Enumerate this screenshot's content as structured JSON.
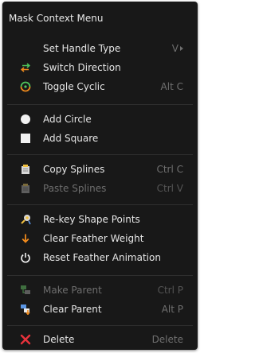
{
  "menu": {
    "title": "Mask Context Menu",
    "items": [
      {
        "label": "Set Handle Type",
        "shortcut": "V",
        "icon": "none"
      },
      {
        "label": "Switch Direction",
        "shortcut": "",
        "icon": "switch-direction-icon"
      },
      {
        "label": "Toggle Cyclic",
        "shortcut": "Alt C",
        "icon": "toggle-cyclic-icon"
      },
      {
        "label": "Add Circle",
        "shortcut": "",
        "icon": "circle-icon"
      },
      {
        "label": "Add Square",
        "shortcut": "",
        "icon": "square-icon"
      },
      {
        "label": "Copy Splines",
        "shortcut": "Ctrl C",
        "icon": "copy-icon"
      },
      {
        "label": "Paste Splines",
        "shortcut": "Ctrl V",
        "icon": "paste-icon"
      },
      {
        "label": "Re-key Shape Points",
        "shortcut": "",
        "icon": "rekey-icon"
      },
      {
        "label": "Clear Feather Weight",
        "shortcut": "",
        "icon": "clear-feather-icon"
      },
      {
        "label": "Reset Feather Animation",
        "shortcut": "",
        "icon": "power-icon"
      },
      {
        "label": "Make Parent",
        "shortcut": "Ctrl P",
        "icon": "make-parent-icon"
      },
      {
        "label": "Clear Parent",
        "shortcut": "Alt P",
        "icon": "clear-parent-icon"
      },
      {
        "label": "Delete",
        "shortcut": "Delete",
        "icon": "delete-icon"
      }
    ]
  },
  "colors": {
    "menu_background": "#181818",
    "text": "#e6e6e6",
    "shortcut_text": "#6f6f6f",
    "disabled_text": "#6e6e6e",
    "separator": "#2e2e2e",
    "delete_icon": "#e8323c",
    "arrow_green": "#4fc45b",
    "arrow_orange": "#f08a1c",
    "parent_blue": "#5a96e6"
  }
}
